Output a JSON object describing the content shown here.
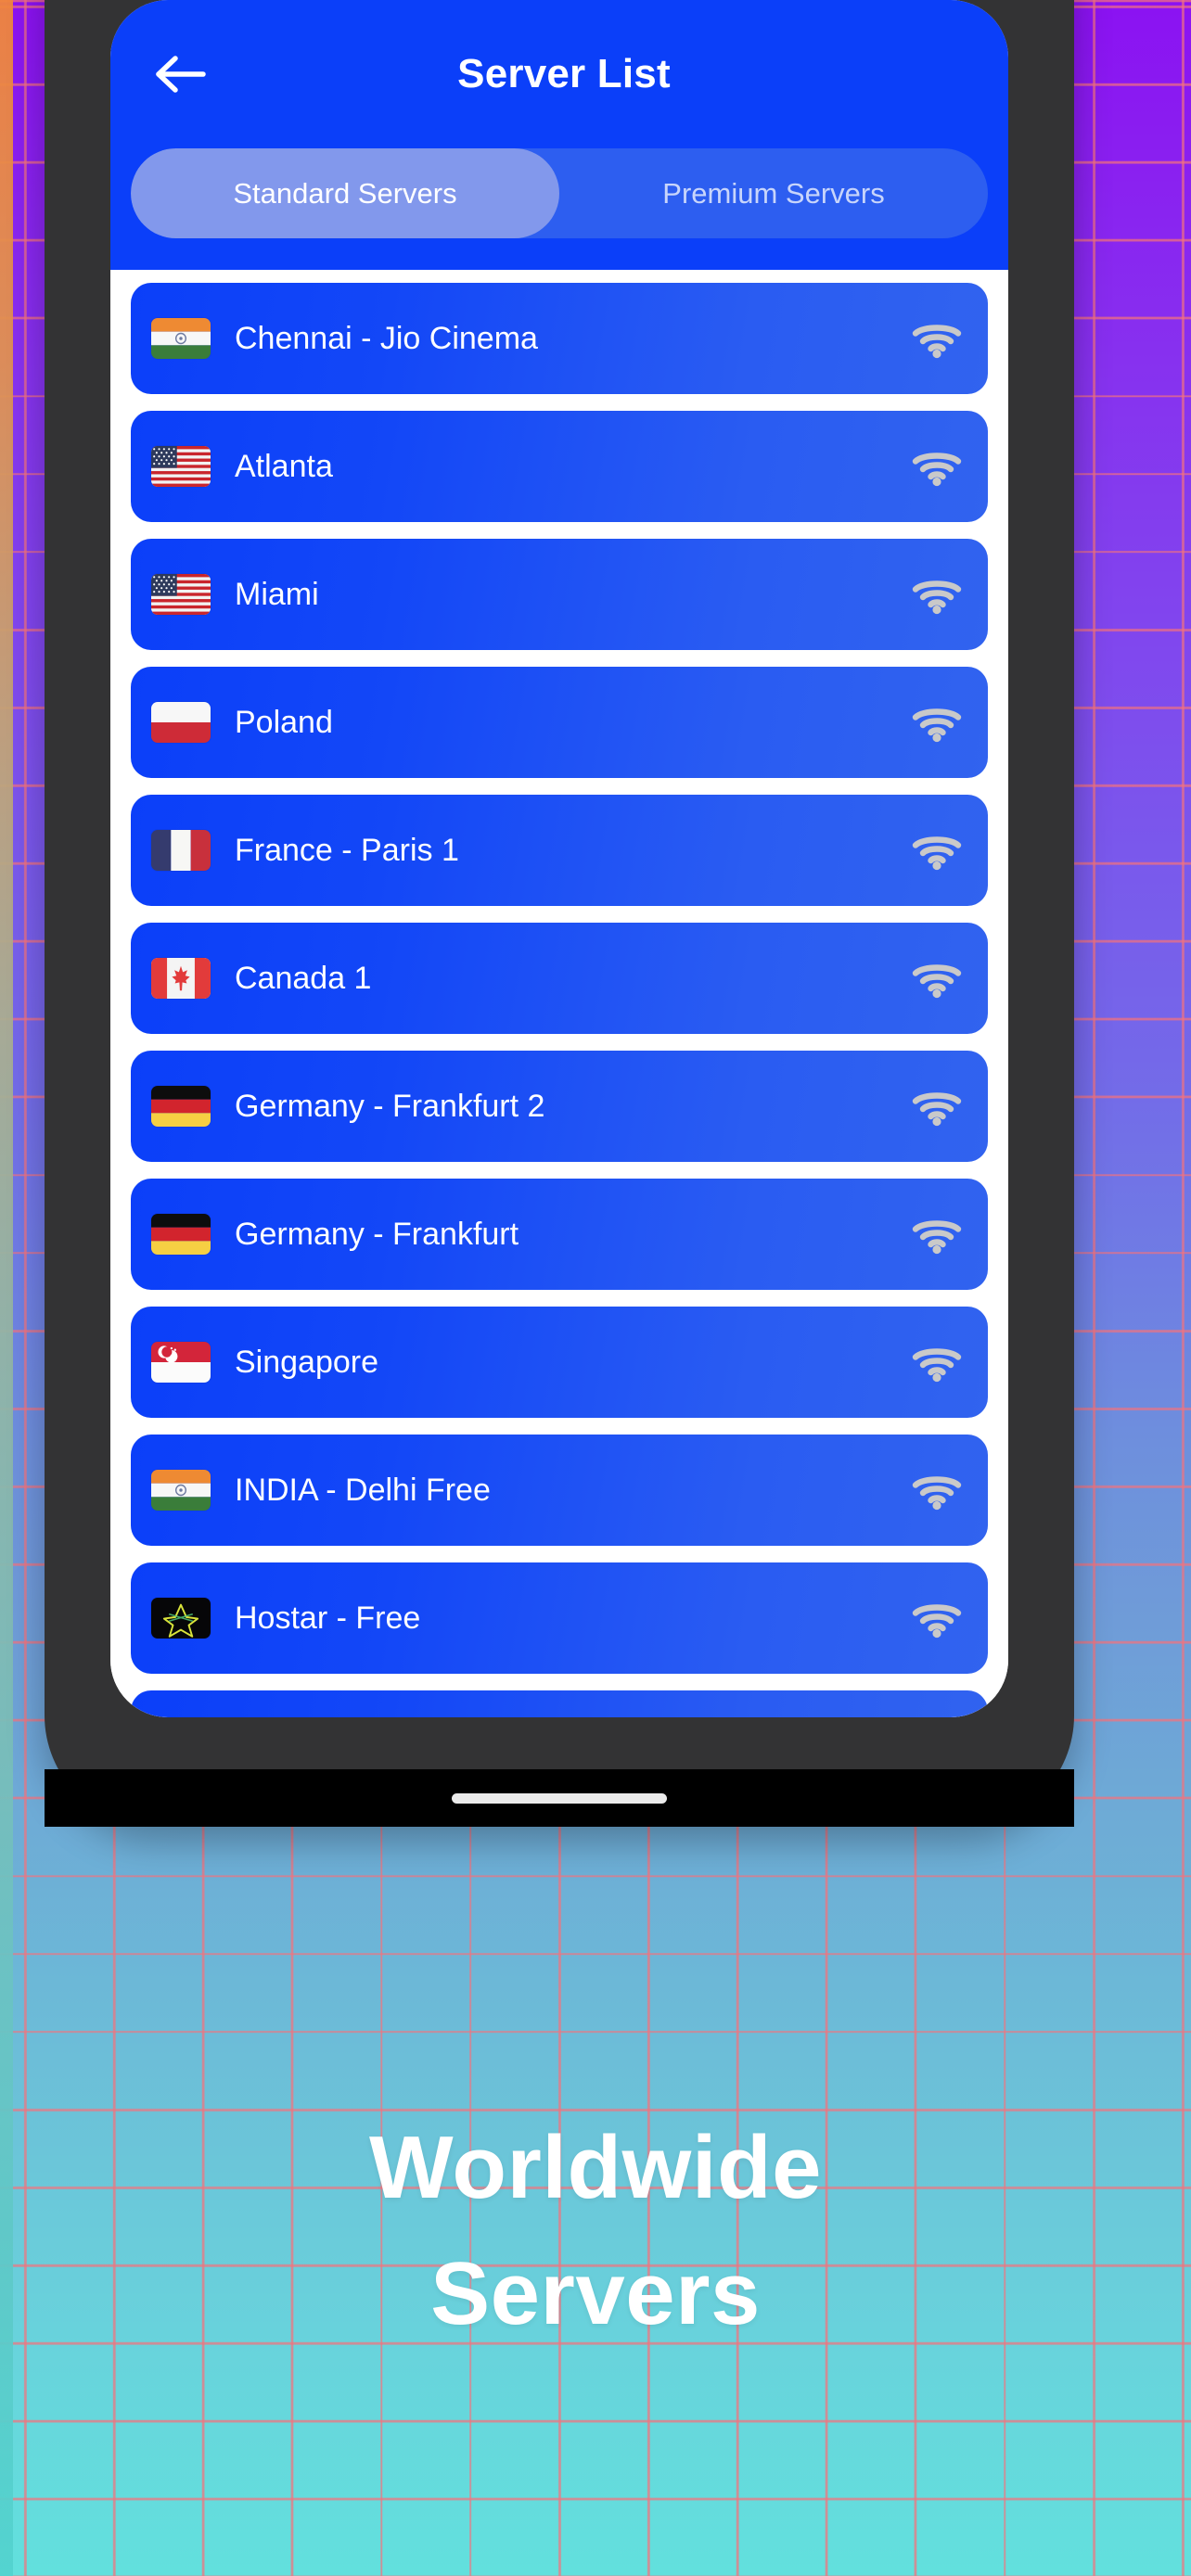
{
  "background": {
    "gradient_top": "#8b12f2",
    "gradient_bottom": "#62e0dd",
    "grid_line_color": "#f4727c"
  },
  "app": {
    "accent": "#0b3ff9",
    "header": {
      "title": "Server List",
      "back_icon": "arrow-left-icon"
    },
    "tabs": [
      {
        "label": "Standard Servers",
        "active": true
      },
      {
        "label": "Premium Servers",
        "active": false
      }
    ],
    "servers": [
      {
        "name": "Chennai -  Jio Cinema",
        "flag": "in",
        "signal": "wifi-icon"
      },
      {
        "name": "Atlanta",
        "flag": "us",
        "signal": "wifi-icon"
      },
      {
        "name": "Miami",
        "flag": "us",
        "signal": "wifi-icon"
      },
      {
        "name": "Poland",
        "flag": "pl",
        "signal": "wifi-icon"
      },
      {
        "name": "France - Paris 1",
        "flag": "fr",
        "signal": "wifi-icon"
      },
      {
        "name": "Canada 1",
        "flag": "ca",
        "signal": "wifi-icon"
      },
      {
        "name": "Germany - Frankfurt 2",
        "flag": "de",
        "signal": "wifi-icon"
      },
      {
        "name": "Germany - Frankfurt",
        "flag": "de",
        "signal": "wifi-icon"
      },
      {
        "name": "Singapore",
        "flag": "sg",
        "signal": "wifi-icon"
      },
      {
        "name": "INDIA - Delhi Free",
        "flag": "in",
        "signal": "wifi-icon"
      },
      {
        "name": "Hostar - Free",
        "flag": "hotstar",
        "signal": "wifi-icon"
      },
      {
        "name": "",
        "flag": "none",
        "signal": "wifi-icon"
      }
    ]
  },
  "caption": {
    "line1": "Worldwide",
    "line2": "Servers"
  }
}
